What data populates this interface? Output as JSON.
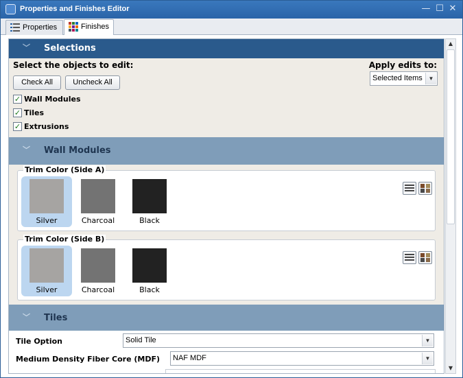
{
  "window": {
    "title": "Properties and Finishes Editor",
    "minimize": "—",
    "restore": "☐",
    "close": "✕"
  },
  "tabs": [
    {
      "label": "Properties",
      "icon": "properties-list-icon"
    },
    {
      "label": "Finishes",
      "icon": "finishes-grid-icon"
    }
  ],
  "selections": {
    "header": "Selections",
    "prompt": "Select the objects to edit:",
    "apply_label": "Apply edits to:",
    "apply_value": "Selected Items",
    "check_all": "Check All",
    "uncheck_all": "Uncheck All",
    "objects": [
      {
        "label": "Wall Modules",
        "checked": true
      },
      {
        "label": "Tiles",
        "checked": true
      },
      {
        "label": "Extrusions",
        "checked": true
      }
    ]
  },
  "wall_modules": {
    "header": "Wall Modules",
    "groups": [
      {
        "title": "Trim Color (Side A)",
        "swatches": [
          {
            "name": "Silver",
            "color": "#a6a4a2",
            "selected": true
          },
          {
            "name": "Charcoal",
            "color": "#737373",
            "selected": false
          },
          {
            "name": "Black",
            "color": "#222222",
            "selected": false
          }
        ]
      },
      {
        "title": "Trim Color (Side B)",
        "swatches": [
          {
            "name": "Silver",
            "color": "#a6a4a2",
            "selected": true
          },
          {
            "name": "Charcoal",
            "color": "#737373",
            "selected": false
          },
          {
            "name": "Black",
            "color": "#222222",
            "selected": false
          }
        ]
      }
    ]
  },
  "tiles": {
    "header": "Tiles",
    "tile_option_label": "Tile Option",
    "tile_option_value": "Solid Tile",
    "mdf_label": "Medium Density Fiber Core (MDF)",
    "mdf_value": "NAF MDF"
  },
  "colors": {
    "title_bar": "#2a64a8",
    "section_dark": "#2a5a8c",
    "section_mid": "#7f9db9",
    "selection_highlight": "#bcd6f0"
  }
}
